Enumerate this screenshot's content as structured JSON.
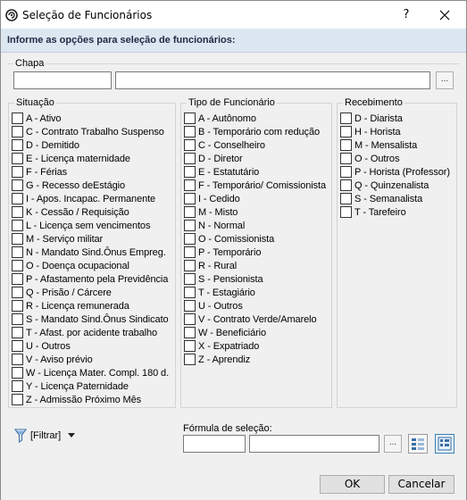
{
  "window": {
    "title": "Seleção de Funcionários",
    "help": "?"
  },
  "header": {
    "text": "Informe as opções para seleção de funcionários:"
  },
  "chapa": {
    "label": "Chapa",
    "value_from": "",
    "value_to": "",
    "browse": "..."
  },
  "situacao": {
    "label": "Situação",
    "items": [
      {
        "label": "A - Ativo",
        "checked": false
      },
      {
        "label": "C - Contrato Trabalho Suspenso",
        "checked": false
      },
      {
        "label": "D - Demitido",
        "checked": false
      },
      {
        "label": "E - Licença maternidade",
        "checked": false
      },
      {
        "label": "F - Férias",
        "checked": false
      },
      {
        "label": "G - Recesso deEstágio",
        "checked": false
      },
      {
        "label": "I - Apos. Incapac. Permanente",
        "checked": false
      },
      {
        "label": "K - Cessão / Requisição",
        "checked": false
      },
      {
        "label": "L - Licença sem vencimentos",
        "checked": false
      },
      {
        "label": "M - Serviço militar",
        "checked": false
      },
      {
        "label": "N - Mandato Sind.Ônus Empreg.",
        "checked": false
      },
      {
        "label": "O - Doença ocupacional",
        "checked": false
      },
      {
        "label": "P - Afastamento pela Previdência",
        "checked": false
      },
      {
        "label": "Q - Prisão / Cárcere",
        "checked": false
      },
      {
        "label": "R - Licença remunerada",
        "checked": false
      },
      {
        "label": "S - Mandato Sind.Ônus Sindicato",
        "checked": false
      },
      {
        "label": "T - Afast. por acidente trabalho",
        "checked": false
      },
      {
        "label": "U - Outros",
        "checked": false
      },
      {
        "label": "V - Aviso prévio",
        "checked": false
      },
      {
        "label": "W - Licença Mater. Compl. 180 d.",
        "checked": false
      },
      {
        "label": "Y - Licença Paternidade",
        "checked": false
      },
      {
        "label": "Z - Admissão Próximo Mês",
        "checked": false
      }
    ]
  },
  "tipo": {
    "label": "Tipo de Funcionário",
    "items": [
      {
        "label": "A - Autônomo",
        "checked": false
      },
      {
        "label": "B - Temporário com redução",
        "checked": false
      },
      {
        "label": "C - Conselheiro",
        "checked": false
      },
      {
        "label": "D - Diretor",
        "checked": false
      },
      {
        "label": "E - Estatutário",
        "checked": false
      },
      {
        "label": "F - Temporário/ Comissionista",
        "checked": false
      },
      {
        "label": "I - Cedido",
        "checked": false
      },
      {
        "label": "M - Misto",
        "checked": false
      },
      {
        "label": "N - Normal",
        "checked": false
      },
      {
        "label": "O - Comissionista",
        "checked": false
      },
      {
        "label": "P - Temporário",
        "checked": false
      },
      {
        "label": "R - Rural",
        "checked": false
      },
      {
        "label": "S - Pensionista",
        "checked": false
      },
      {
        "label": "T - Estagiário",
        "checked": false
      },
      {
        "label": "U - Outros",
        "checked": false
      },
      {
        "label": "V - Contrato Verde/Amarelo",
        "checked": false
      },
      {
        "label": "W - Beneficiário",
        "checked": false
      },
      {
        "label": "X - Expatriado",
        "checked": false
      },
      {
        "label": "Z - Aprendiz",
        "checked": false
      }
    ]
  },
  "recebimento": {
    "label": "Recebimento",
    "items": [
      {
        "label": "D - Diarista",
        "checked": false
      },
      {
        "label": "H - Horista",
        "checked": false
      },
      {
        "label": "M - Mensalista",
        "checked": false
      },
      {
        "label": "O - Outros",
        "checked": false
      },
      {
        "label": "P - Horista (Professor)",
        "checked": false
      },
      {
        "label": "Q - Quinzenalista",
        "checked": false
      },
      {
        "label": "S - Semanalista",
        "checked": false
      },
      {
        "label": "T - Tarefeiro",
        "checked": false
      }
    ]
  },
  "filter": {
    "label": "[Filtrar]"
  },
  "formula": {
    "label": "Fórmula de seleção:",
    "value_a": "",
    "value_b": "",
    "browse": "..."
  },
  "buttons": {
    "ok": "OK",
    "cancel": "Cancelar"
  },
  "colors": {
    "header_band": "#dde7f2",
    "accent": "#3c7fb1"
  }
}
